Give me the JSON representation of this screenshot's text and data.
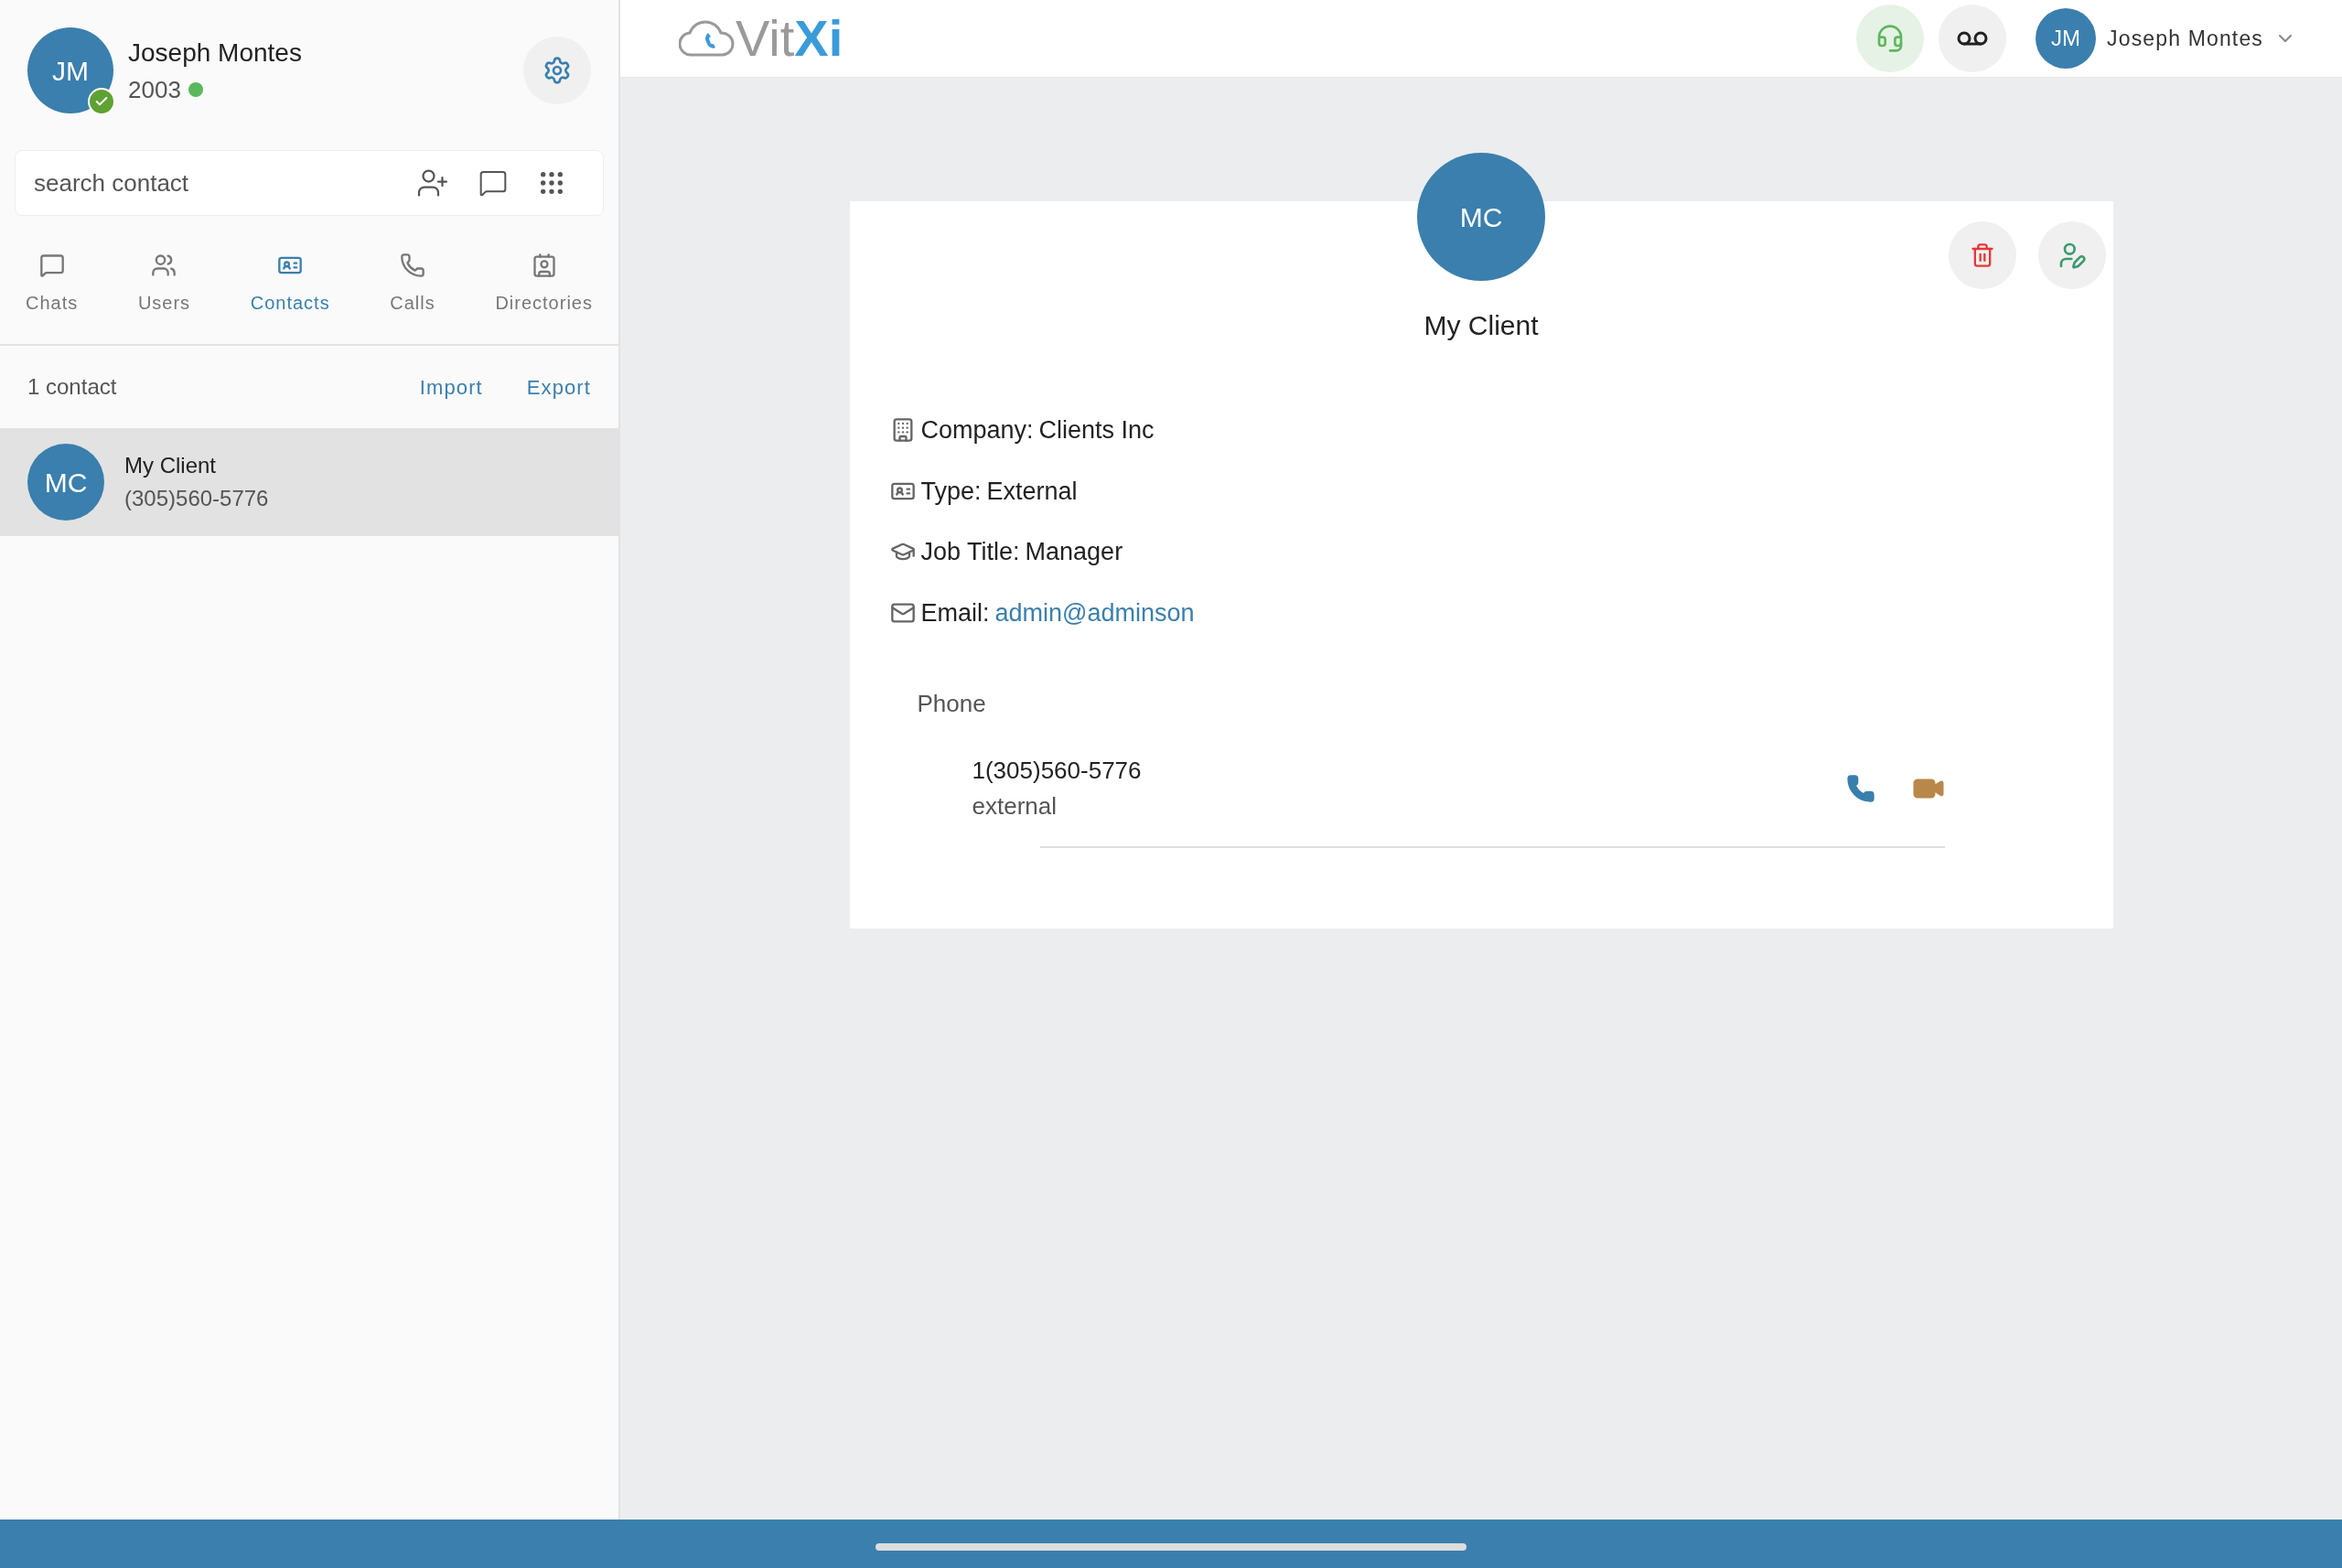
{
  "user": {
    "initials": "JM",
    "name": "Joseph Montes",
    "extension": "2003",
    "online": true,
    "verified": true
  },
  "search": {
    "placeholder": "search contact"
  },
  "tabs": [
    {
      "label": "Chats",
      "kind": "chat",
      "selected": false
    },
    {
      "label": "Users",
      "kind": "users",
      "selected": false
    },
    {
      "label": "Contacts",
      "kind": "contacts",
      "selected": true
    },
    {
      "label": "Calls",
      "kind": "phone",
      "selected": false
    },
    {
      "label": "Directories",
      "kind": "directory",
      "selected": false
    }
  ],
  "contact_list": {
    "count": "1 contact",
    "actions": [
      "Import",
      "Export"
    ],
    "items": [
      {
        "initials": "MC",
        "name": "My Client",
        "phone": "(305)560-5776",
        "selected": true
      }
    ]
  },
  "header": {
    "logo_light": "Vit",
    "logo_bold": "Xi",
    "user_initials": "JM",
    "user_name": "Joseph Montes"
  },
  "contact": {
    "initials": "MC",
    "name": "My Client",
    "details": [
      {
        "kind": "company",
        "label": "Company:",
        "value": "Clients Inc"
      },
      {
        "kind": "type",
        "label": "Type:",
        "value": "External"
      },
      {
        "kind": "job",
        "label": "Job Title:",
        "value": "Manager"
      },
      {
        "kind": "email",
        "label": "Email:",
        "value": "admin@adminson"
      }
    ],
    "phone_heading": "Phone",
    "phones": [
      {
        "number": "1(305)560-5776",
        "type": "external"
      }
    ]
  }
}
